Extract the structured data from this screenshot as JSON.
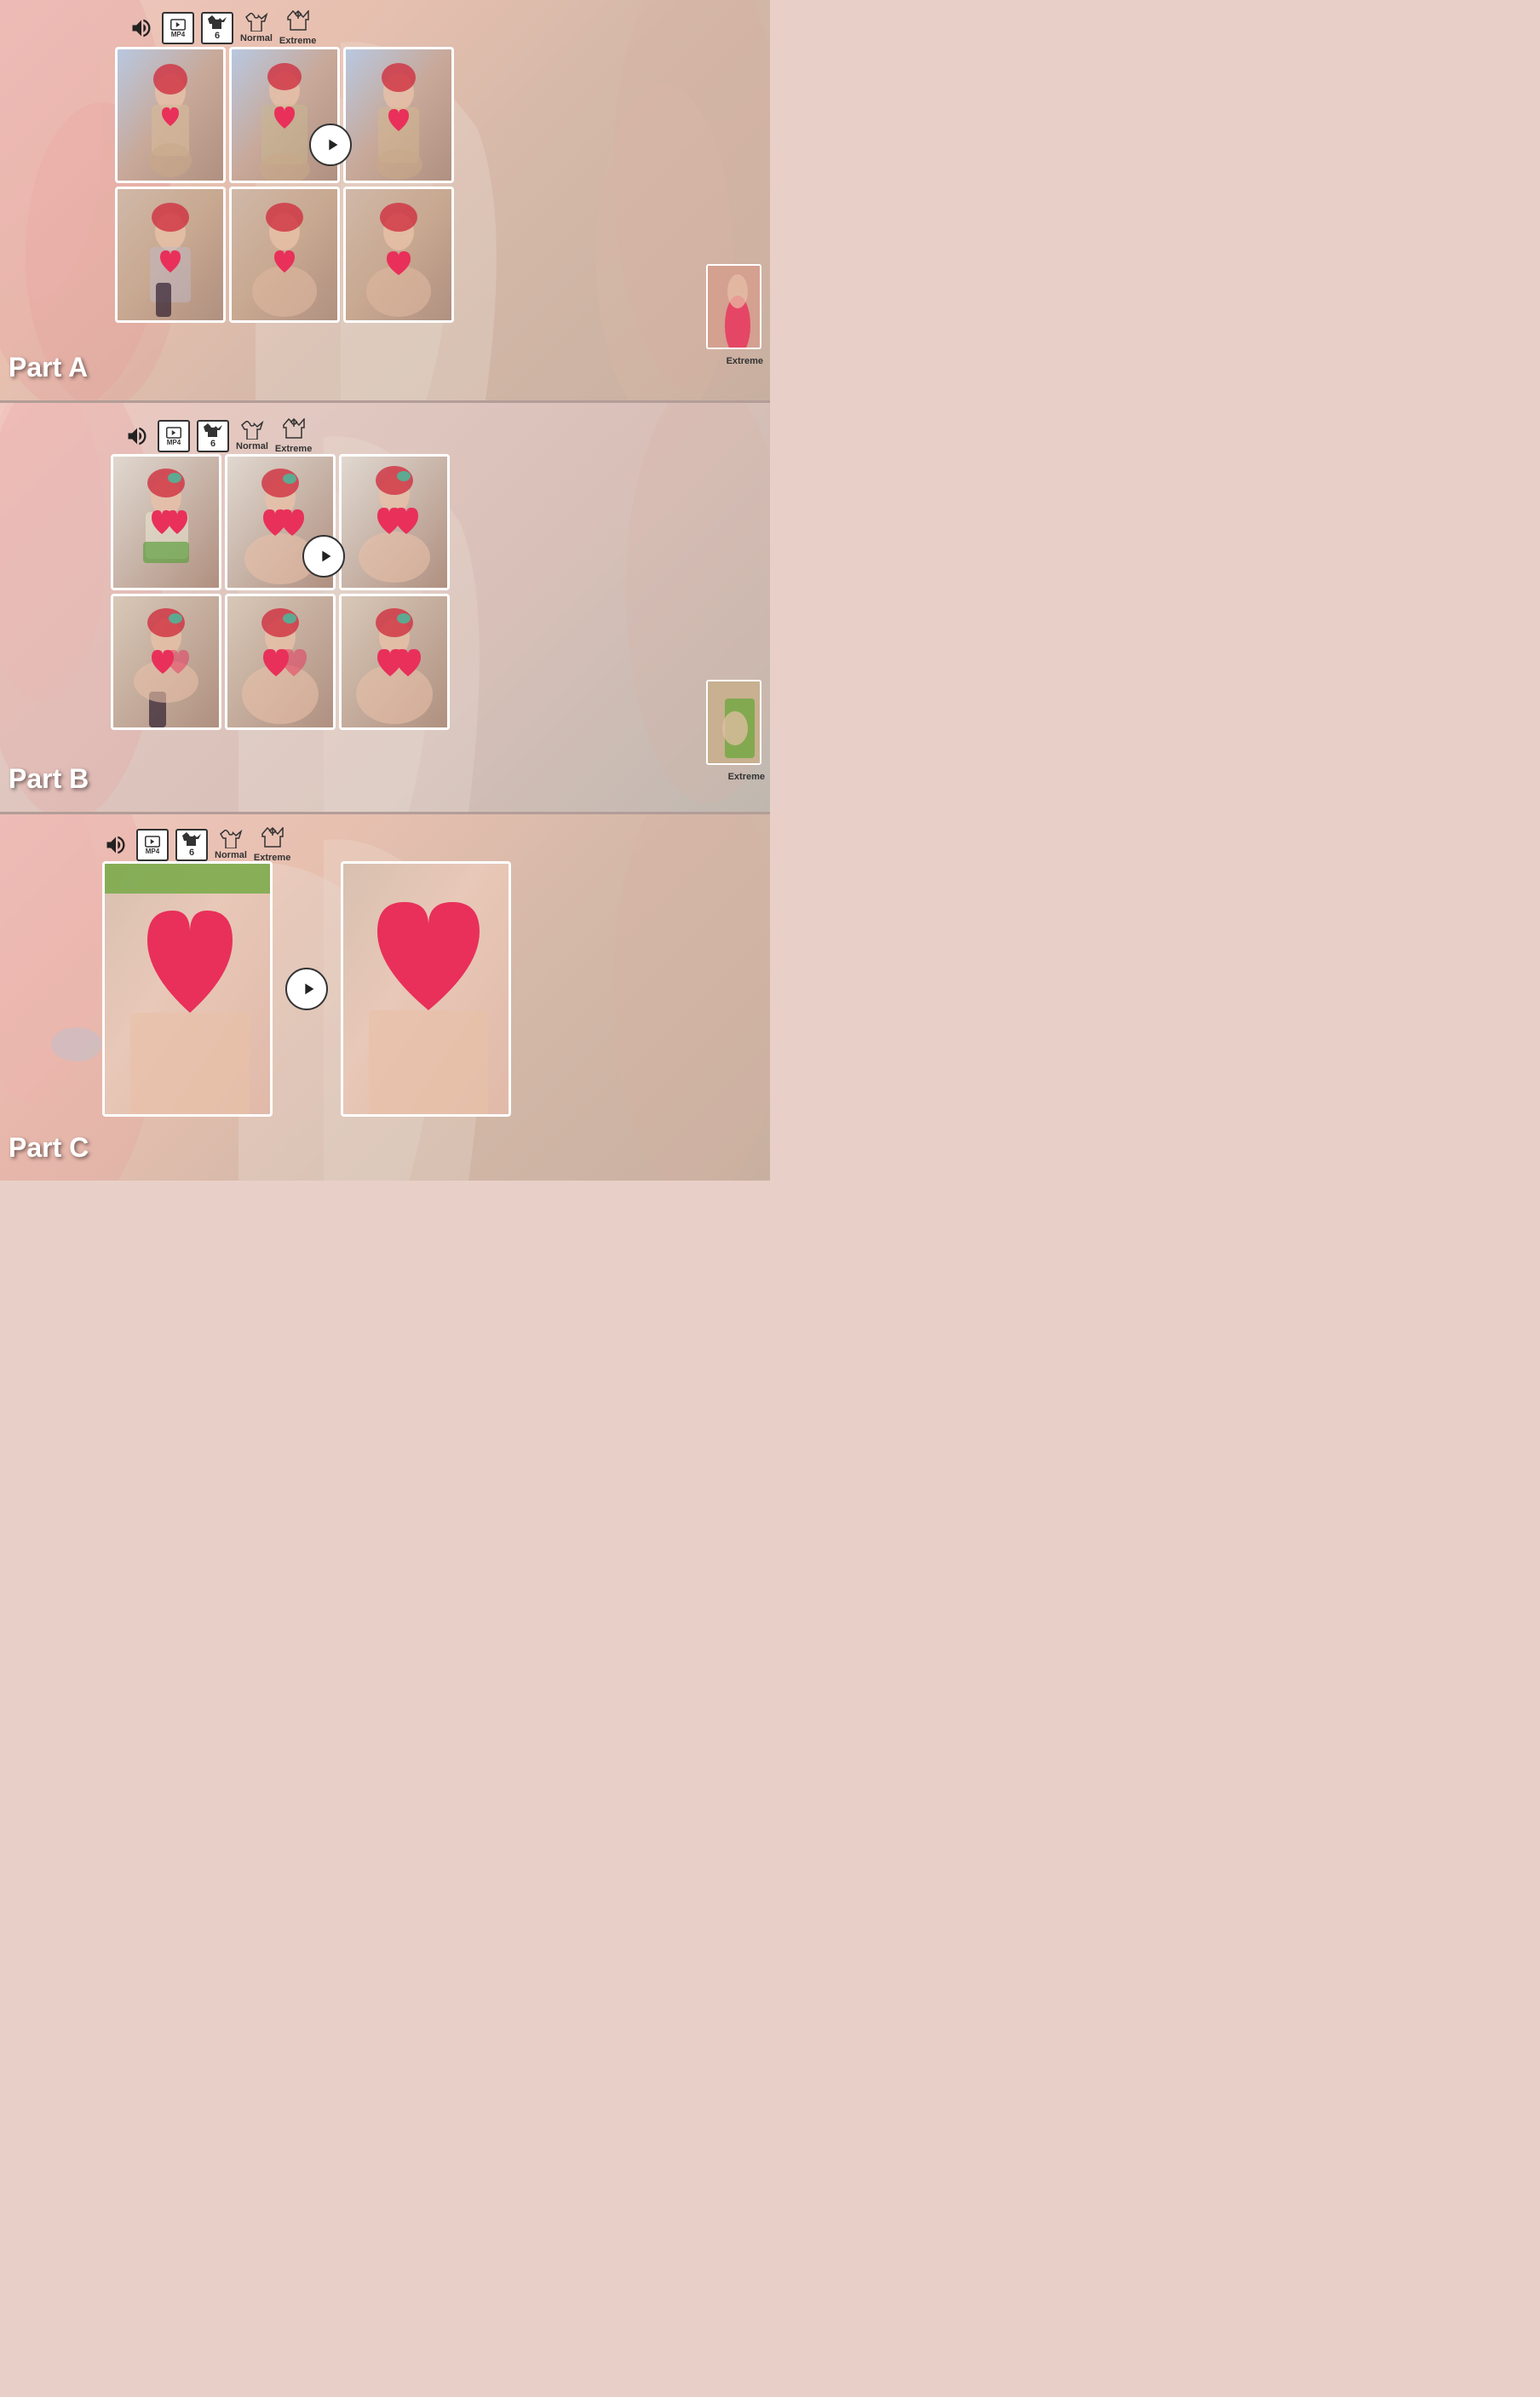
{
  "sections": [
    {
      "id": "part-a",
      "label": "Part A",
      "controls": {
        "sound_label": "sound",
        "mp4_label": "MP4",
        "badge_num": "6",
        "normal_label": "Normal",
        "extreme_label": "Extreme"
      },
      "extreme_thumb_label": "Extreme",
      "thumbs": [
        {
          "id": "a1",
          "row": 0,
          "col": 0
        },
        {
          "id": "a2",
          "row": 0,
          "col": 1
        },
        {
          "id": "a3",
          "row": 0,
          "col": 2
        },
        {
          "id": "a4",
          "row": 1,
          "col": 0
        },
        {
          "id": "a5",
          "row": 1,
          "col": 1
        },
        {
          "id": "a6",
          "row": 1,
          "col": 2
        }
      ]
    },
    {
      "id": "part-b",
      "label": "Part B",
      "controls": {
        "sound_label": "sound",
        "mp4_label": "MP4",
        "badge_num": "6",
        "normal_label": "Normal",
        "extreme_label": "Extreme"
      },
      "extreme_thumb_label": "Extreme",
      "thumbs": [
        {
          "id": "b1",
          "row": 0,
          "col": 0
        },
        {
          "id": "b2",
          "row": 0,
          "col": 1
        },
        {
          "id": "b3",
          "row": 0,
          "col": 2
        },
        {
          "id": "b4",
          "row": 1,
          "col": 0
        },
        {
          "id": "b5",
          "row": 1,
          "col": 1
        },
        {
          "id": "b6",
          "row": 1,
          "col": 2
        }
      ]
    },
    {
      "id": "part-c",
      "label": "Part C",
      "controls": {
        "sound_label": "sound",
        "mp4_label": "MP4",
        "badge_num": "6",
        "normal_label": "Normal",
        "extreme_label": "Extreme"
      },
      "thumbs": [
        {
          "id": "c1"
        },
        {
          "id": "c2"
        }
      ]
    }
  ],
  "colors": {
    "heart": "#e8305a",
    "white": "#ffffff",
    "dark": "#222222",
    "accent": "#e8305a"
  },
  "icons": {
    "sound": "🔊",
    "play": "▶",
    "tshirt": "👕"
  }
}
